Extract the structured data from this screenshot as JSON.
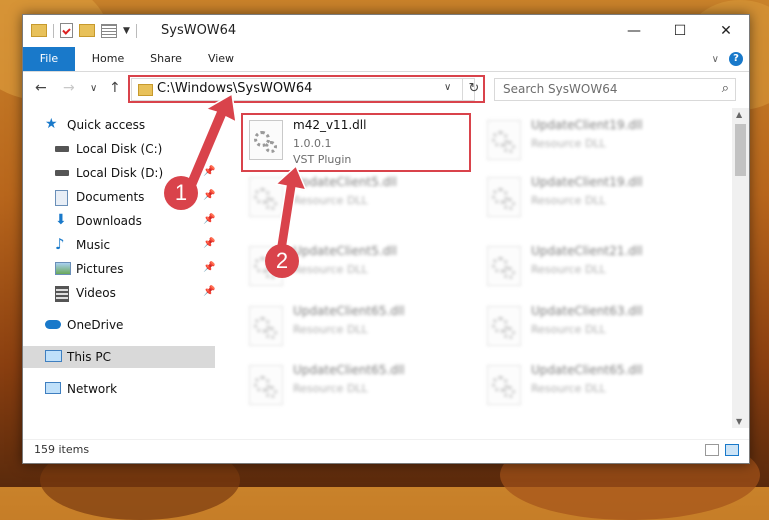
{
  "window": {
    "title": "SysWOW64",
    "controls": {
      "minimize": "—",
      "maximize": "☐",
      "close": "✕"
    }
  },
  "ribbon": {
    "tabs": [
      "File",
      "Home",
      "Share",
      "View"
    ],
    "help": "?",
    "expand": "∨"
  },
  "navigation": {
    "back": "←",
    "forward": "→",
    "recent": "∨",
    "up": "↑",
    "address": "C:\\Windows\\SysWOW64",
    "address_dropdown": "∨",
    "refresh": "↻",
    "search_placeholder": "Search SysWOW64",
    "search_icon": "⌕"
  },
  "sidebar": {
    "items": [
      {
        "label": "Quick access",
        "icon": "star-icon",
        "pinned": false
      },
      {
        "label": "Local Disk (C:)",
        "icon": "drive-icon",
        "pinned": true
      },
      {
        "label": "Local Disk (D:)",
        "icon": "drive-icon",
        "pinned": true
      },
      {
        "label": "Documents",
        "icon": "documents-icon",
        "pinned": true
      },
      {
        "label": "Downloads",
        "icon": "downloads-icon",
        "pinned": true
      },
      {
        "label": "Music",
        "icon": "music-icon",
        "pinned": true
      },
      {
        "label": "Pictures",
        "icon": "pictures-icon",
        "pinned": true
      },
      {
        "label": "Videos",
        "icon": "videos-icon",
        "pinned": true
      },
      {
        "label": "OneDrive",
        "icon": "cloud-icon",
        "pinned": false
      },
      {
        "label": "This PC",
        "icon": "computer-icon",
        "pinned": false,
        "selected": true
      },
      {
        "label": "Network",
        "icon": "network-icon",
        "pinned": false
      }
    ]
  },
  "files": [
    {
      "name": "m42_v11.dll",
      "line1": "1.0.0.1",
      "line2": "VST Plugin",
      "highlighted": true
    },
    {
      "name": "UpdateClient19.dll",
      "line1": "Resource DLL"
    },
    {
      "name": "UpdateClient5.dll",
      "line1": "Resource DLL"
    },
    {
      "name": "UpdateClient19.dll",
      "line1": "Resource DLL"
    },
    {
      "name": "UpdateClient5.dll",
      "line1": "Resource DLL"
    },
    {
      "name": "UpdateClient21.dll",
      "line1": "Resource DLL"
    },
    {
      "name": "UpdateClient65.dll",
      "line1": "Resource DLL"
    },
    {
      "name": "UpdateClient63.dll",
      "line1": "Resource DLL"
    },
    {
      "name": "UpdateClient65.dll",
      "line1": "Resource DLL"
    },
    {
      "name": "UpdateClient65.dll",
      "line1": "Resource DLL"
    }
  ],
  "status": {
    "item_count": "159 items"
  },
  "annotations": {
    "step1": "1",
    "step2": "2"
  },
  "colors": {
    "accent": "#1979ca",
    "highlight": "#d9434b",
    "selected": "#d9d9d9"
  }
}
